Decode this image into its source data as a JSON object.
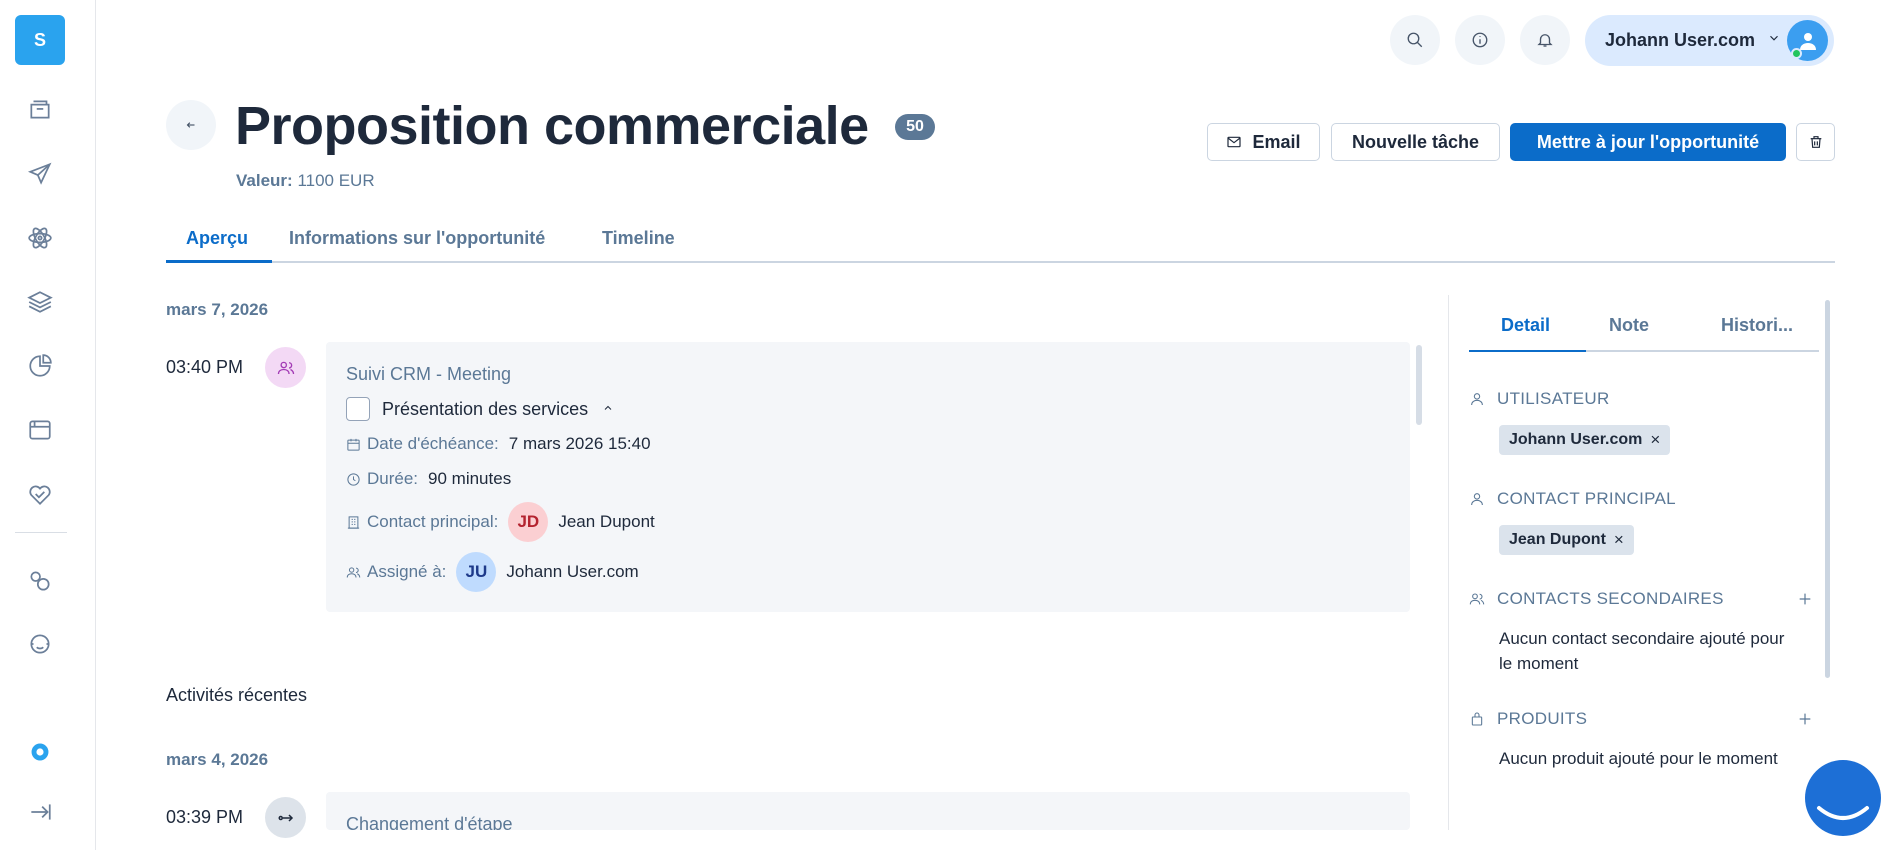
{
  "sidebar": {
    "logo": "S",
    "icons": [
      "folder-icon",
      "send-icon",
      "atom-icon",
      "layers-icon",
      "pie-chart-icon",
      "window-icon",
      "heart-handshake-icon",
      "connections-icon",
      "support-icon",
      "settings-icon",
      "logout-icon"
    ]
  },
  "header": {
    "user_name": "Johann User.com"
  },
  "page": {
    "title": "Proposition commerciale",
    "badge": "50",
    "value_label": "Valeur:",
    "value": "1100 EUR"
  },
  "actions": {
    "email": "Email",
    "new_task": "Nouvelle tâche",
    "update": "Mettre à jour l'opportunité"
  },
  "tabs": [
    "Aperçu",
    "Informations sur l'opportunité",
    "Timeline"
  ],
  "timeline": {
    "date1": "mars 7, 2026",
    "time1": "03:40 PM",
    "card1": {
      "title": "Suivi CRM - Meeting",
      "task": "Présentation des services",
      "due_label": "Date d'échéance:",
      "due_value": "7 mars 2026 15:40",
      "duration_label": "Durée:",
      "duration_value": "90 minutes",
      "contact_label": "Contact principal:",
      "contact_initials": "JD",
      "contact_name": "Jean Dupont",
      "assigned_label": "Assigné à:",
      "assigned_initials": "JU",
      "assigned_name": "Johann User.com"
    },
    "recent_heading": "Activités récentes",
    "date2": "mars 4, 2026",
    "time2": "03:39 PM",
    "card2_title": "Changement d'étape"
  },
  "right_panel": {
    "tabs": [
      "Detail",
      "Note",
      "Histori..."
    ],
    "user_section": "UTILISATEUR",
    "user_chip": "Johann User.com",
    "main_contact_section": "CONTACT PRINCIPAL",
    "main_contact_chip": "Jean Dupont",
    "secondary_section": "CONTACTS SECONDAIRES",
    "secondary_empty": "Aucun contact secondaire ajouté pour le moment",
    "products_section": "PRODUITS",
    "products_empty": "Aucun produit ajouté pour le moment",
    "chip_remove": "×"
  },
  "colors": {
    "primary": "#0b6cc9",
    "muted": "#5b7896",
    "logo": "#2aa3ee"
  }
}
